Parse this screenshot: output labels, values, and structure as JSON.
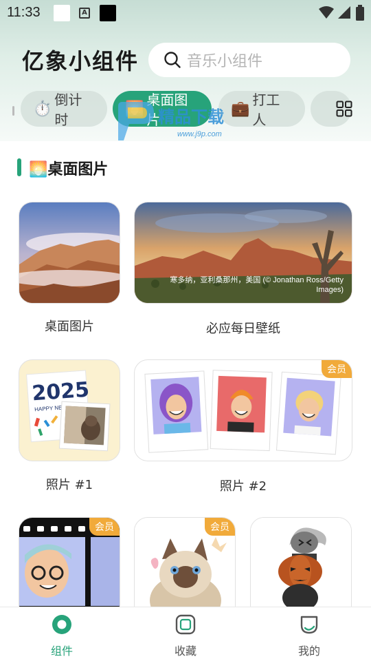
{
  "status_bar": {
    "time": "11:33",
    "indicator": "A"
  },
  "header": {
    "app_title": "亿象小组件",
    "search_placeholder": "音乐小组件"
  },
  "tabs": [
    {
      "emoji": "⏱️",
      "label": "倒计时"
    },
    {
      "emoji": "🌅",
      "label": "桌面图片",
      "active": true
    },
    {
      "emoji": "💼",
      "label": "打工人"
    }
  ],
  "watermark": {
    "brand": "精品下载",
    "url": "www.j9p.com"
  },
  "section": {
    "emoji": "🌅",
    "title": "桌面图片"
  },
  "cards": [
    {
      "label": "桌面图片",
      "vip": false
    },
    {
      "label": "必应每日壁纸",
      "caption": "寒多纳，亚利桑那州，美国 (© Jonathan Ross/Getty Images)",
      "vip": false
    },
    {
      "label": "照片 #1",
      "year_text": "2025",
      "greeting_text": "HAPPY NEW Y",
      "vip": false
    },
    {
      "label": "照片 #2",
      "vip": true
    },
    {
      "vip": true
    },
    {
      "vip": true
    },
    {
      "vip": false
    }
  ],
  "vip_label": "会员",
  "bottom_nav": [
    {
      "label": "组件",
      "icon": "widget-icon",
      "active": true
    },
    {
      "label": "收藏",
      "icon": "collect-icon"
    },
    {
      "label": "我的",
      "icon": "profile-icon"
    }
  ],
  "colors": {
    "accent": "#27a37a",
    "vip": "#f1aa3a"
  }
}
